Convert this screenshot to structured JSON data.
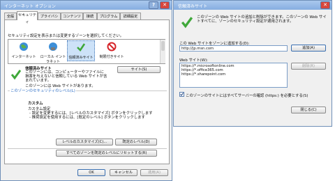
{
  "main": {
    "title": "インターネット オプション",
    "help_glyph": "?",
    "close_glyph": "✕",
    "tabs": [
      "全般",
      "セキュリティ",
      "プライバシー",
      "コンテンツ",
      "接続",
      "プログラム",
      "詳細設定"
    ],
    "zone_prompt": "セキュリティ設定を表示または変更するゾーンを選択してください。",
    "zones": [
      {
        "label": "インターネット",
        "icon": "globe-icon"
      },
      {
        "label": "ローカル イント ラネット",
        "icon": "intranet-icon"
      },
      {
        "label": "信頼済みサイト",
        "icon": "checkmark-icon"
      },
      {
        "label": "制限付きサイト",
        "icon": "restricted-icon"
      }
    ],
    "zone_name": "信頼済みサイト",
    "zone_desc": "このゾーンには、コンピューターやファイルに損害を与えないと信頼している Web サイトが含まれています。",
    "sites_button": "サイト(S)",
    "zone_has_sites": "このゾーンには Web サイトがあります。",
    "security_level_label": "このゾーンのセキュリティのレベル(L)",
    "level_name": "カスタム",
    "level_subtitle": "カスタム設定",
    "level_bullets": [
      "- 設定を変更するには、[レベルのカスタマイズ] ボタンをクリックします",
      "- 推奨設定を使用するには、[既定のレベル] ボタンをクリックします"
    ],
    "customize_button": "レベルのカスタマイズ(C)...",
    "default_level_button": "既定のレベル(D)",
    "reset_all_button": "すべてのゾーンを既定のレベルにリセットする(R)",
    "ok_button": "OK",
    "cancel_button": "キャンセル",
    "apply_button": "適用(A)",
    "colors": {
      "title_bar": "#86aee0",
      "accent": "#2b6cc4",
      "check_green": "#3fa83a",
      "restricted_red": "#d6252a"
    }
  },
  "dialog": {
    "title": "信頼済みサイト",
    "close_glyph": "✕",
    "info_text": "このゾーンの Web サイトの追加と削除ができます。このゾーンの Web サイトすべてに、ゾーンのセキュリティ設定が適用されます。",
    "add_label": "この Web サイトをゾーンに追加する(D):",
    "add_value": "http://jp.msn.com",
    "add_button": "追加(A)",
    "sites_label": "Web サイト(W):",
    "sites": [
      "https://*.microsoftonline.com",
      "https://*.office365.com",
      "https://*.sharepoint.com"
    ],
    "remove_button": "削除(R)",
    "https_checkbox_label": "このゾーンのサイトにはすべてサーバーの確認 (https:) を必要とする(S)",
    "https_checked": true,
    "close_button": "閉じる(C)"
  }
}
